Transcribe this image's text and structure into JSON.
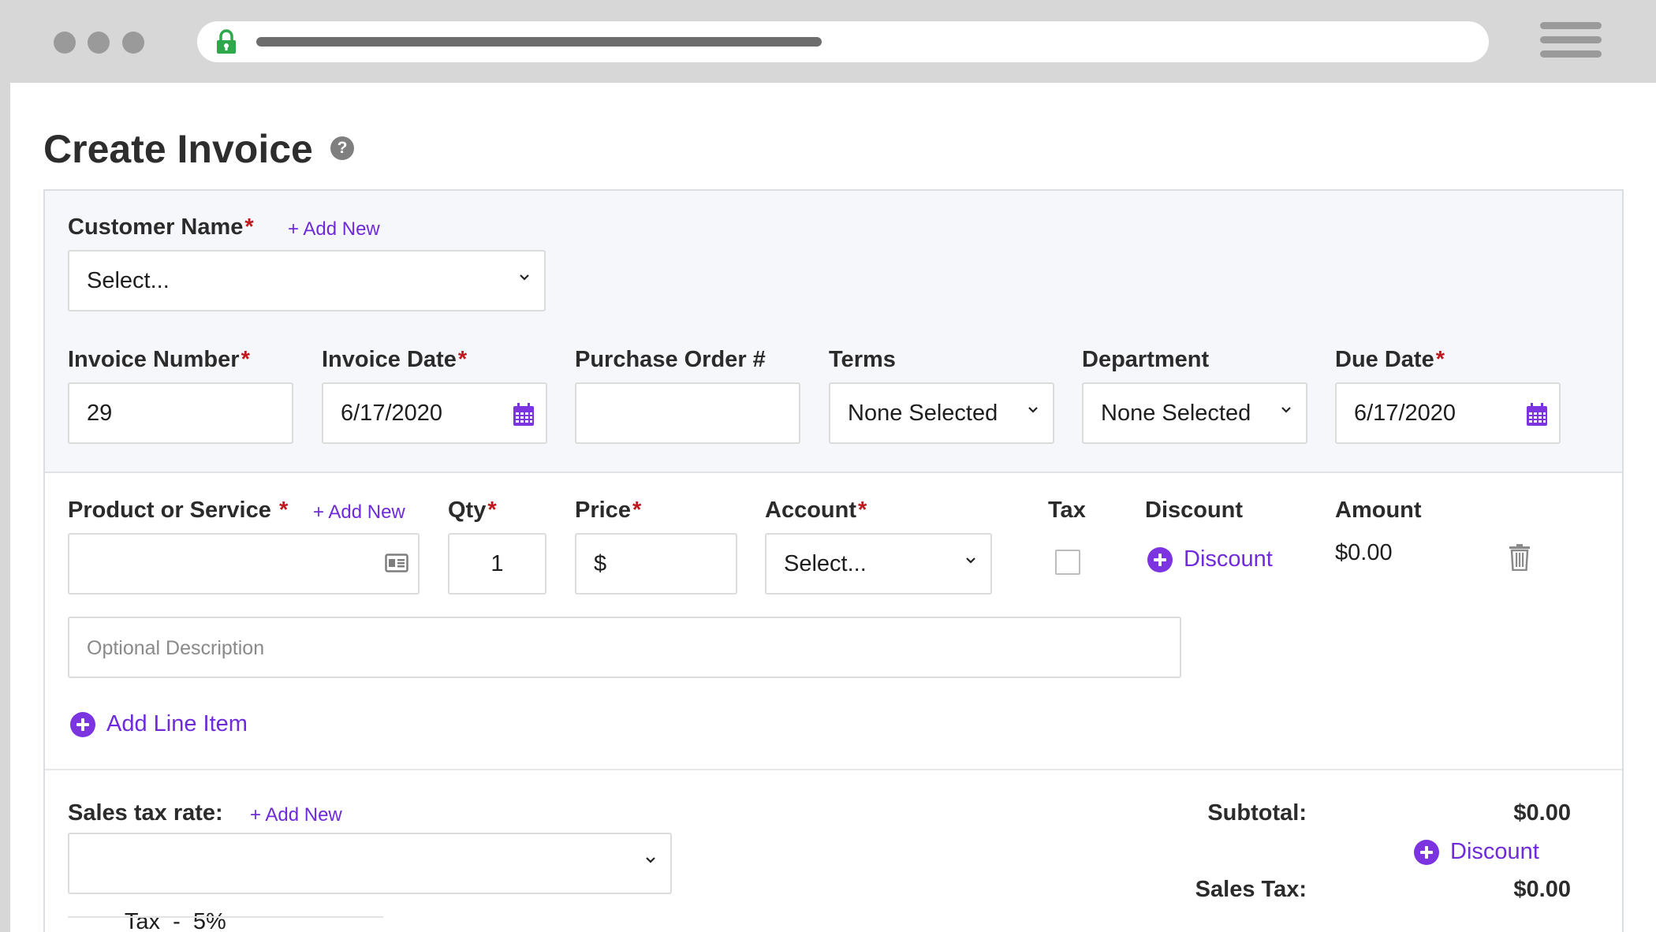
{
  "page": {
    "title": "Create Invoice",
    "help_icon": "question-circle-icon"
  },
  "customer": {
    "label": "Customer Name",
    "required": "*",
    "add_new": "+ Add New",
    "value": "Select..."
  },
  "details": {
    "invoice_number": {
      "label": "Invoice Number",
      "required": "*",
      "value": "29"
    },
    "invoice_date": {
      "label": "Invoice Date",
      "required": "*",
      "value": "6/17/2020"
    },
    "purchase_order": {
      "label": "Purchase Order #",
      "value": ""
    },
    "terms": {
      "label": "Terms",
      "value": "None Selected"
    },
    "department": {
      "label": "Department",
      "value": "None Selected"
    },
    "due_date": {
      "label": "Due Date",
      "required": "*",
      "value": "6/17/2020"
    }
  },
  "line_item": {
    "product": {
      "label": "Product or Service",
      "required": "*",
      "add_new": "+ Add New",
      "value": ""
    },
    "qty": {
      "label": "Qty",
      "required": "*",
      "value": "1"
    },
    "price": {
      "label": "Price",
      "required": "*",
      "value": "$"
    },
    "account": {
      "label": "Account",
      "required": "*",
      "value": "Select..."
    },
    "tax": {
      "label": "Tax",
      "checked": false
    },
    "discount": {
      "label": "Discount",
      "link": "Discount"
    },
    "amount": {
      "label": "Amount",
      "value": "$0.00"
    },
    "description_placeholder": "Optional Description"
  },
  "add_line_item": "Add Line Item",
  "sales_tax": {
    "label": "Sales tax rate:",
    "add_new": "+ Add New",
    "value": "Tax  -  5%"
  },
  "totals": {
    "subtotal_label": "Subtotal:",
    "subtotal_value": "$0.00",
    "discount_link": "Discount",
    "sales_tax_label": "Sales Tax:",
    "sales_tax_value": "$0.00"
  },
  "colors": {
    "accent": "#7b34e0",
    "required": "#c0171d",
    "lock": "#2ea84a"
  }
}
